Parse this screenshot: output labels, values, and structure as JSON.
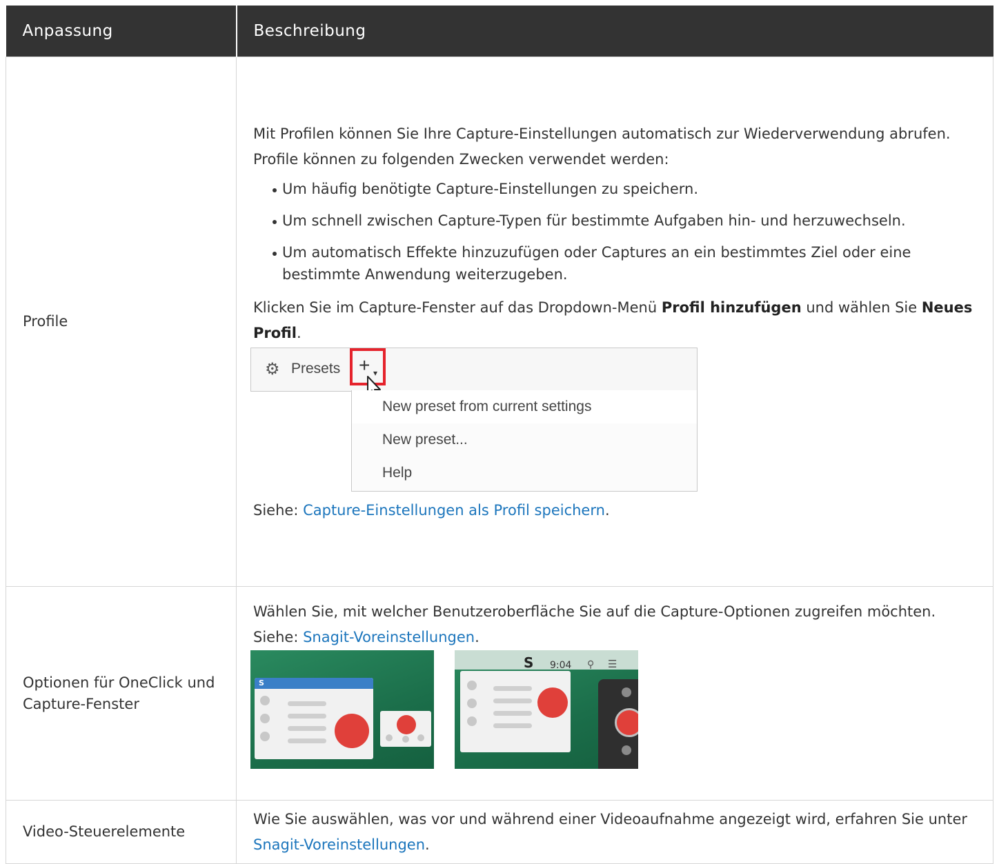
{
  "headers": {
    "col1": "Anpassung",
    "col2": "Beschreibung"
  },
  "rows": {
    "profile": {
      "name": "Profile",
      "intro": "Mit Profilen können Sie Ihre Capture-Einstellungen automatisch zur Wiederverwendung abrufen. Profile können zu folgenden Zwecken verwendet werden:",
      "bullets": [
        "Um häufig benötigte Capture-Einstellungen zu speichern.",
        "Um schnell zwischen Capture-Typen für bestimmte Aufgaben hin- und herzuwechseln.",
        "Um automatisch Effekte hinzuzufügen oder Captures an ein bestimmtes Ziel oder eine bestimmte Anwendung weiterzugeben."
      ],
      "instruction_pre": "Klicken Sie im Capture-Fenster auf das Dropdown-Menü ",
      "instruction_bold1": "Profil hinzufügen",
      "instruction_mid": " und wählen Sie ",
      "instruction_bold2": "Neues Profil",
      "instruction_post": ".",
      "screenshot": {
        "presets_label": "Presets",
        "plus_symbol": "+",
        "menu_items": [
          "New preset from current settings",
          "New preset...",
          "Help"
        ]
      },
      "see_prefix": "Siehe: ",
      "see_link": "Capture-Einstellungen als Profil speichern",
      "see_suffix": "."
    },
    "optionen": {
      "name": "Optionen für OneClick und Capture-Fenster",
      "text_pre": "Wählen Sie, mit welcher Benutzeroberfläche Sie auf die Capture-Optionen zugreifen möchten. Siehe: ",
      "link": "Snagit-Voreinstellungen",
      "text_post": ".",
      "shot1_badge": "S",
      "shot2_logo": "S",
      "shot2_time": "9:04"
    },
    "video": {
      "name": "Video-Steuerelemente",
      "text_pre": "Wie Sie auswählen, was vor und während einer Videoaufnahme angezeigt wird, erfahren Sie unter ",
      "link": "Snagit-Voreinstellungen",
      "text_post": "."
    }
  },
  "colors": {
    "header_bg": "#333333",
    "link": "#1b75bc",
    "highlight_box": "#e5232c"
  }
}
